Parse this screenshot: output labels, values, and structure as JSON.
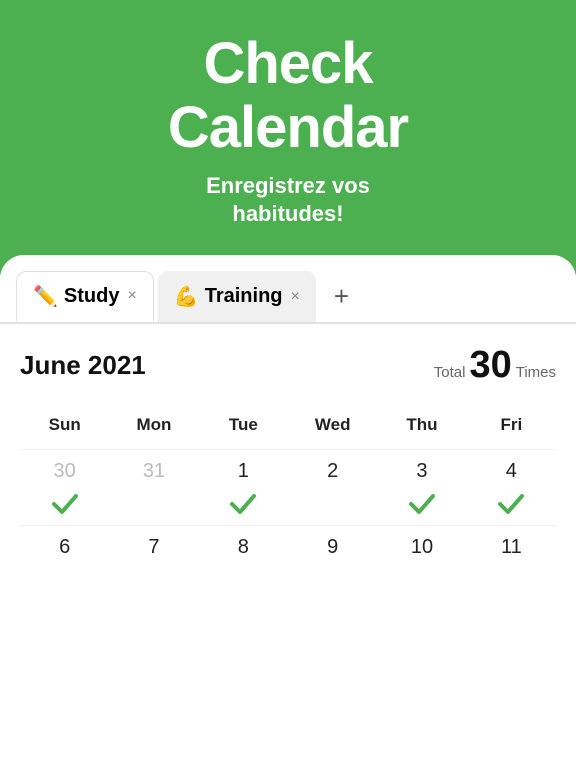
{
  "header": {
    "title_line1": "Check",
    "title_line2": "Calendar",
    "subtitle_line1": "Enregistrez vos",
    "subtitle_line2": "habitudes!"
  },
  "tabs": [
    {
      "id": "study",
      "emoji": "✏️",
      "label": "Study",
      "active": true
    },
    {
      "id": "training",
      "emoji": "💪",
      "label": "Training",
      "active": false
    }
  ],
  "add_button": "+",
  "calendar": {
    "month": "June 2021",
    "total_label": "Total",
    "total_number": "30",
    "total_times": "Times",
    "day_headers": [
      "Sun",
      "Mon",
      "Tue",
      "Wed",
      "Thu",
      "Fri"
    ],
    "weeks": [
      [
        {
          "number": "30",
          "muted": true,
          "check": true
        },
        {
          "number": "31",
          "muted": true,
          "check": false
        },
        {
          "number": "1",
          "muted": false,
          "check": true
        },
        {
          "number": "2",
          "muted": false,
          "check": false
        },
        {
          "number": "3",
          "muted": false,
          "check": true
        },
        {
          "number": "4",
          "muted": false,
          "check": true
        }
      ],
      [
        {
          "number": "6",
          "muted": false,
          "check": false
        },
        {
          "number": "7",
          "muted": false,
          "check": false
        },
        {
          "number": "8",
          "muted": false,
          "check": false
        },
        {
          "number": "9",
          "muted": false,
          "check": false
        },
        {
          "number": "10",
          "muted": false,
          "check": false
        },
        {
          "number": "11",
          "muted": false,
          "check": false
        }
      ]
    ]
  },
  "colors": {
    "green": "#4CAF50",
    "check_green": "#4CAF50"
  }
}
